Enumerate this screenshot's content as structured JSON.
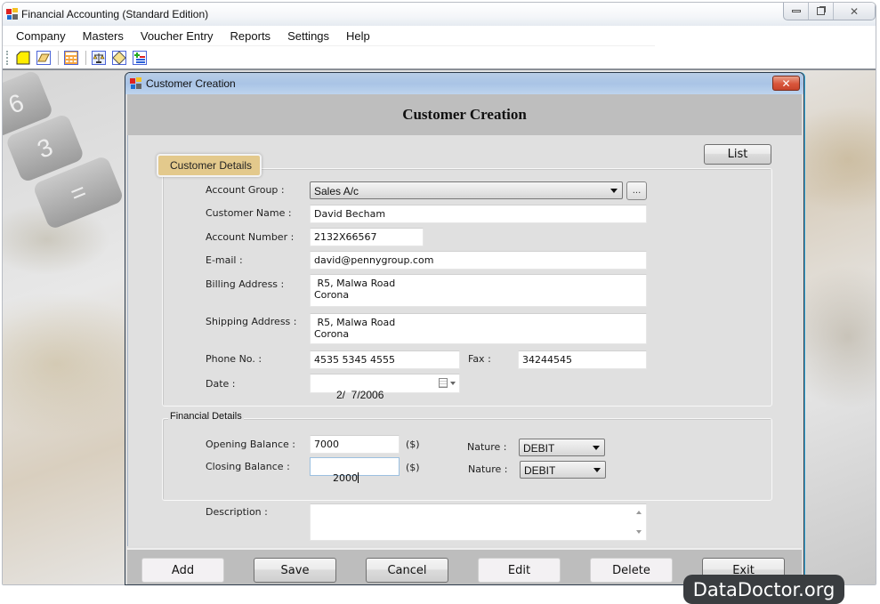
{
  "app": {
    "title": "Financial Accounting (Standard Edition)",
    "window_controls": {
      "minimize": "—",
      "restore": "❐",
      "close": "✕"
    }
  },
  "menu": [
    {
      "label": "Company"
    },
    {
      "label": "Masters"
    },
    {
      "label": "Voucher Entry"
    },
    {
      "label": "Reports"
    },
    {
      "label": "Settings"
    },
    {
      "label": "Help"
    }
  ],
  "toolbar": {
    "icons": [
      "new-file-icon",
      "open-folder-icon",
      "calculator-icon",
      "balance-scale-icon",
      "ledger-icon",
      "add-list-icon"
    ]
  },
  "dialog": {
    "title": "Customer Creation",
    "close": "✕",
    "header_title": "Customer Creation",
    "list_button": "List",
    "customer_details": {
      "tab_label": "Customer Details",
      "account_group": {
        "label": "Account Group :",
        "value": "Sales A/c",
        "browse": "..."
      },
      "customer_name": {
        "label": "Customer Name :",
        "value": "David Becham"
      },
      "account_number": {
        "label": "Account Number :",
        "value": "2132X66567"
      },
      "email": {
        "label": "E-mail :",
        "value": "david@pennygroup.com"
      },
      "billing_address": {
        "label": "Billing Address :",
        "value": " R5, Malwa Road\nCorona"
      },
      "shipping_address": {
        "label": "Shipping Address :",
        "value": " R5, Malwa Road\nCorona"
      },
      "phone": {
        "label": "Phone No. :",
        "value": "4535 5345 4555"
      },
      "fax": {
        "label": "Fax :",
        "value": "34244545"
      },
      "date": {
        "label": "Date :",
        "value": "2/  7/2006"
      }
    },
    "financial_details": {
      "legend": "Financial Details",
      "opening_balance": {
        "label": "Opening Balance :",
        "value": "7000",
        "unit": "($)"
      },
      "closing_balance": {
        "label": "Closing Balance :",
        "value": "2000",
        "unit": "($)"
      },
      "opening_nature": {
        "label": "Nature :",
        "value": "DEBIT"
      },
      "closing_nature": {
        "label": "Nature :",
        "value": "DEBIT"
      }
    },
    "description": {
      "label": "Description :",
      "value": ""
    },
    "buttons": {
      "add": "Add",
      "save": "Save",
      "cancel": "Cancel",
      "edit": "Edit",
      "delete": "Delete",
      "exit": "Exit"
    }
  },
  "watermark": "DataDoctor.org"
}
